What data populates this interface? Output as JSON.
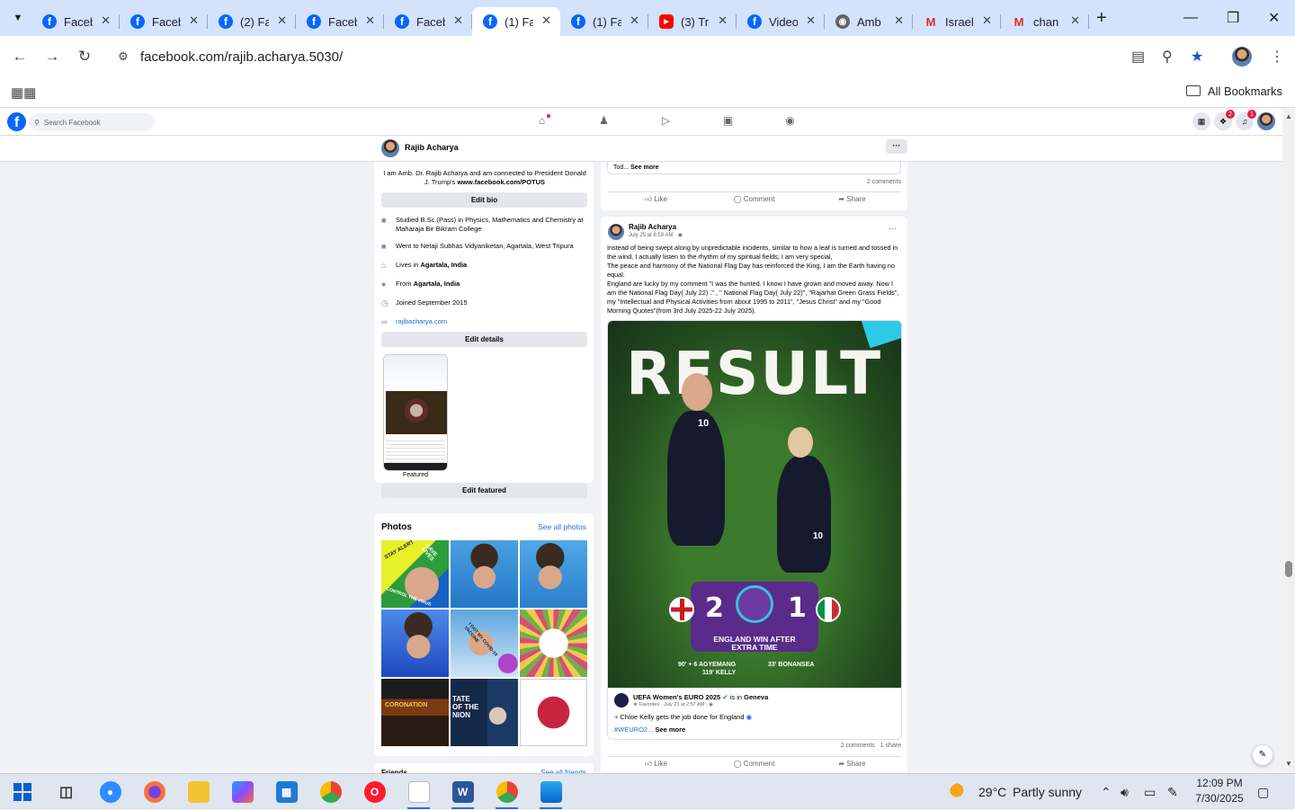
{
  "browser": {
    "tabs": [
      {
        "title": "Faceb",
        "icon": "facebook-icon"
      },
      {
        "title": "Faceb",
        "icon": "facebook-icon"
      },
      {
        "title": "(2) Fa",
        "icon": "facebook-icon"
      },
      {
        "title": "Faceb",
        "icon": "facebook-icon"
      },
      {
        "title": "Faceb",
        "icon": "facebook-icon"
      },
      {
        "title": "(1) Fa",
        "icon": "facebook-icon",
        "active": true
      },
      {
        "title": "(1) Fa",
        "icon": "facebook-icon"
      },
      {
        "title": "(3) Tr",
        "icon": "youtube-icon"
      },
      {
        "title": "Video",
        "icon": "facebook-icon"
      },
      {
        "title": "Amb",
        "icon": "globe-icon"
      },
      {
        "title": "Israel",
        "icon": "gmail-icon"
      },
      {
        "title": "chan",
        "icon": "gmail-icon"
      }
    ],
    "url": "facebook.com/rajib.acharya.5030/",
    "all_bookmarks": "All Bookmarks"
  },
  "facebook": {
    "search_placeholder": "Search Facebook",
    "messenger_badge": "2",
    "notifications_badge": "1",
    "profile_name": "Rajib Acharya",
    "more_label": "···"
  },
  "intro": {
    "bio_text": "I am Amb. Dr. Rajib Acharya and am connected to President Donald J. Trump's ",
    "bio_link": "www.facebook.com/POTUS",
    "edit_bio": "Edit bio",
    "studied": "Studied B.Sc.(Pass) in Physics, Mathematics and Chemistry at Maharaja Bir Bikram College",
    "went_to": "Went to Netaji Subhas Vidyaniketan, Agartala, West Tripura",
    "lives_prefix": "Lives in ",
    "lives": "Agartala, India",
    "from_prefix": "From ",
    "from": "Agartala, India",
    "joined": "Joined September 2015",
    "website": "rajibacharya.com",
    "edit_details": "Edit details",
    "featured_label": "Featured",
    "edit_featured": "Edit featured"
  },
  "photos": {
    "title": "Photos",
    "see_all": "See all photos",
    "tile_texts": {
      "p1a": "STAY ALERT",
      "p1b": "SAVE LIVES",
      "p1c": "CONTROL THE VIRUS",
      "p5": "I GOT MY COVID-19 VACCINE",
      "p7": "CORONATION",
      "p8a": "TATE",
      "p8b": "OF THE",
      "p8c": "NION"
    },
    "friends_title": "Friends",
    "see_all_friends": "See all friends"
  },
  "post_a": {
    "truncated": "Tod...",
    "see_more": "See more",
    "comments": "2 comments",
    "like": "Like",
    "comment": "Comment",
    "share": "Share"
  },
  "post_b": {
    "author": "Rajib Acharya",
    "date": "July 25 at 8:59 AM",
    "text": "Instead of being swept along by unpredictable incidents, similar to how a leaf is turned and tossed in the wind, I actually listen to the rhythm of my spiritual fields; I am very special,\nThe peace and harmony of the National Flag Day has reinforced the King, I am the Earth having no equal.\nEngland are lucky by my comment \"I was the hunted. I know I have grown and moved away. Now I am the National Flag Day( July 22) .\" , \" National Flag Day( July 22)\", \"Rajarhat Green Grass Fields\", my \"Intellectual and Physical Activities from about 1995 to 2011\", \"Jesus Christ\" and my \"Good Morning Quotes\"(from 3rd July 2025-22 July 2025).",
    "image": {
      "headline": "RESULT",
      "home_score": "2",
      "away_score": "1",
      "line1": "ENGLAND WIN AFTER",
      "line2": "EXTRA TIME",
      "home_scorers": "90' + 6 AGYEMANG\n119' KELLY",
      "away_scorers": "33' BONANSEA",
      "shirt_number_1": "10",
      "shirt_number_2": "10"
    },
    "shared_page": "UEFA Women's EURO 2025",
    "is_in": " is in ",
    "place": "Geneva",
    "shared_meta": "★ Favorites · July 23 at 2:57 AM · ",
    "caption": "Chloe Kelly gets the job done for England",
    "hashtag": "#WEURO2...",
    "see_more": "See more",
    "stats": "2 comments   1 share",
    "like": "Like",
    "comment": "Comment",
    "share": "Share"
  },
  "taskbar": {
    "weather": "29°C",
    "weather_desc": "Partly sunny",
    "time": "12:09 PM",
    "date": "7/30/2025"
  }
}
